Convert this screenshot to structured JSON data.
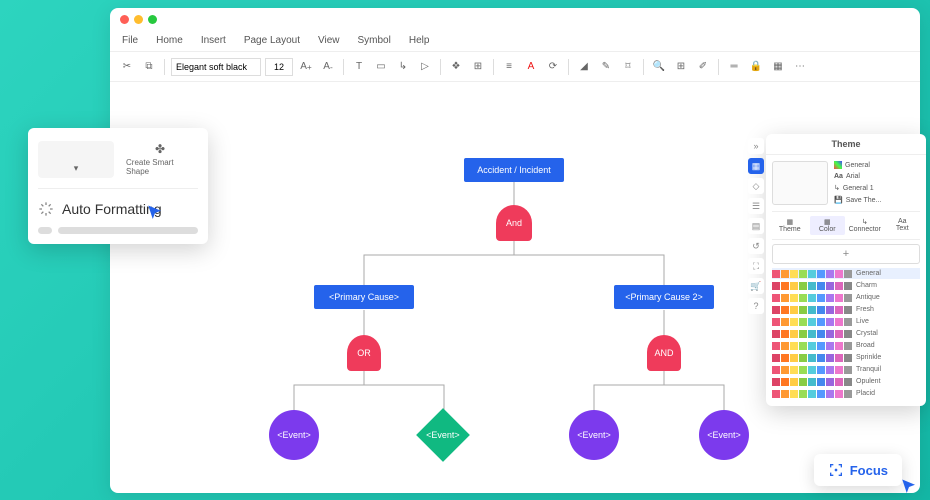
{
  "menu": {
    "file": "File",
    "home": "Home",
    "insert": "Insert",
    "pageLayout": "Page Layout",
    "view": "View",
    "symbol": "Symbol",
    "help": "Help"
  },
  "toolbar": {
    "font": "Elegant soft black",
    "size": "12"
  },
  "diagram": {
    "root": "Accident / Incident",
    "gate1": "And",
    "prim1": "<Primary Cause>",
    "prim2": "<Primary Cause 2>",
    "gate2": "OR",
    "gate3": "AND",
    "ev1": "<Event>",
    "ev2": "<Event>",
    "ev3": "<Event>",
    "ev4": "<Event>"
  },
  "popup": {
    "smartShape": "Create Smart Shape",
    "autoFormat": "Auto Formatting"
  },
  "theme": {
    "title": "Theme",
    "opts": {
      "general": "General",
      "arial": "Arial",
      "general1": "General 1",
      "save": "Save The..."
    },
    "tabs": {
      "theme": "Theme",
      "color": "Color",
      "connector": "Connector",
      "text": "Text"
    },
    "palettes": [
      "General",
      "Charm",
      "Antique",
      "Fresh",
      "Live",
      "Crystal",
      "Broad",
      "Sprinkle",
      "Tranquil",
      "Opulent",
      "Placid"
    ]
  },
  "focus": {
    "label": "Focus"
  }
}
